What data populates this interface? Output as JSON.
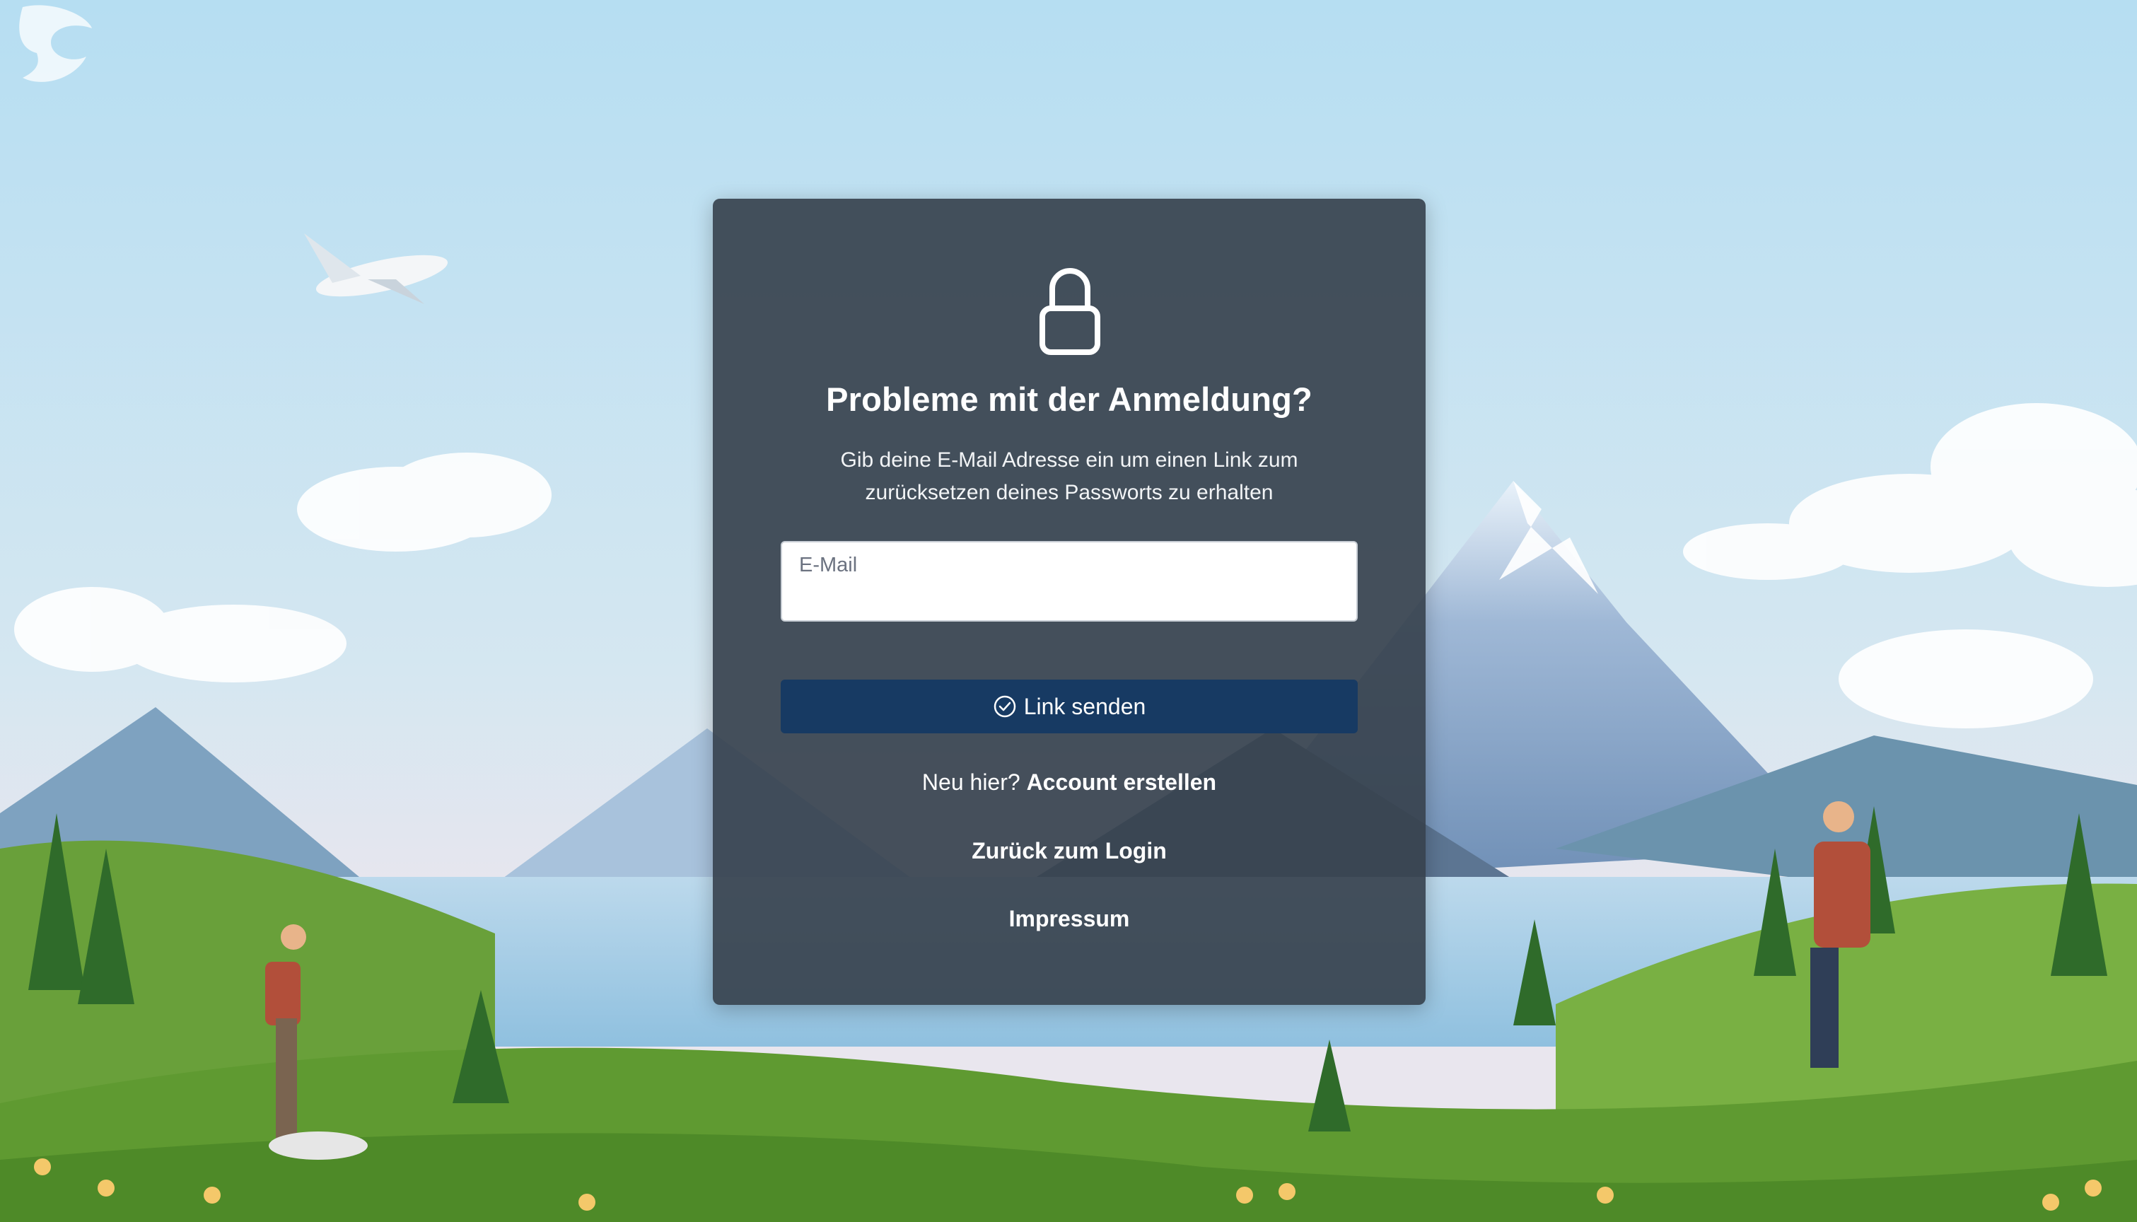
{
  "card": {
    "title": "Probleme mit der Anmeldung?",
    "subtitle": "Gib deine E-Mail Adresse ein um einen Link zum zurücksetzen deines Passworts zu erhalten",
    "email_label": "E-Mail",
    "email_value": "",
    "send_button": "Link senden",
    "new_here_text": "Neu hier? ",
    "create_account_link": "Account erstellen",
    "back_to_login_link": "Zurück zum Login",
    "imprint_link": "Impressum"
  },
  "icons": {
    "logo": "dragon-logo-icon",
    "lock": "lock-icon",
    "send": "check-circle-icon"
  },
  "colors": {
    "card_background": "#37424e",
    "button_background": "#173a63",
    "text": "#ffffff"
  }
}
